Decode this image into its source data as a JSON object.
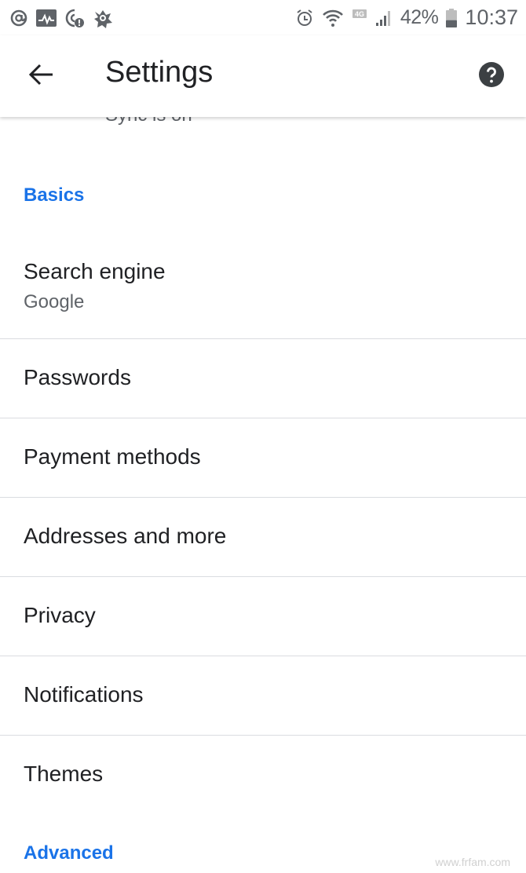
{
  "status_bar": {
    "left_icons": [
      "at-sign-icon",
      "activity-monitor-icon",
      "data-alert-icon",
      "avast-icon"
    ],
    "right_icons": [
      "alarm-icon",
      "wifi-icon",
      "4g-icon",
      "signal-icon"
    ],
    "network_label": "4G",
    "battery_percent": "42%",
    "battery_level": 0.42,
    "time": "10:37"
  },
  "app_bar": {
    "back_icon": "arrow-back-icon",
    "title": "Settings",
    "help_icon": "help-circle-icon"
  },
  "sync_status": "Sync is on",
  "sections": {
    "basics": "Basics",
    "advanced": "Advanced"
  },
  "items": [
    {
      "title": "Search engine",
      "subtitle": "Google"
    },
    {
      "title": "Passwords"
    },
    {
      "title": "Payment methods"
    },
    {
      "title": "Addresses and more"
    },
    {
      "title": "Privacy"
    },
    {
      "title": "Notifications"
    },
    {
      "title": "Themes"
    }
  ],
  "colors": {
    "accent": "#1a73e8",
    "primary_text": "#202124",
    "secondary_text": "#5f6368",
    "divider": "#dadce0"
  },
  "watermark": "www.frfam.com"
}
